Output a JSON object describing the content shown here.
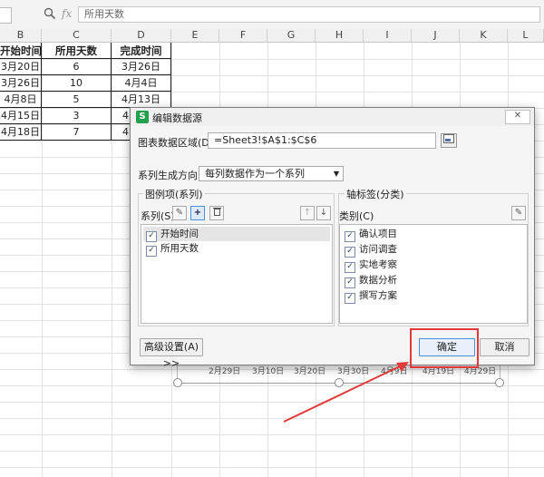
{
  "formula_bar": {
    "fx_label": "fx",
    "value": "所用天数"
  },
  "columns": [
    "B",
    "C",
    "D",
    "E",
    "F",
    "G",
    "H",
    "I",
    "J",
    "K",
    "L"
  ],
  "table": {
    "headers": [
      "开始时间",
      "所用天数",
      "完成时间"
    ],
    "rows": [
      [
        "3月20日",
        "6",
        "3月26日"
      ],
      [
        "3月26日",
        "10",
        "4月4日"
      ],
      [
        "4月8日",
        "5",
        "4月13日"
      ],
      [
        "4月15日",
        "3",
        "4"
      ],
      [
        "4月18日",
        "7",
        "4"
      ]
    ]
  },
  "chart": {
    "x_ticks": [
      "2月29日",
      "3月10日",
      "3月20日",
      "3月30日",
      "4月9日",
      "4月19日",
      "4月29日"
    ]
  },
  "dialog": {
    "title": "编辑数据源",
    "range_label": "图表数据区域(D)：",
    "range_value": "=Sheet3!$A$1:$C$6",
    "series_direction_label": "系列生成方向：",
    "series_direction_value": "每列数据作为一个系列",
    "legend_group_title": "图例项(系列)",
    "series_label": "系列(S)",
    "axis_group_title": "轴标签(分类)",
    "category_label": "类别(C)",
    "series_items": [
      "开始时间",
      "所用天数"
    ],
    "category_items": [
      "确认项目",
      "访问调查",
      "实地考察",
      "数据分析",
      "撰写方案"
    ],
    "advanced_button": "高级设置(A) >>",
    "ok_button": "确定",
    "cancel_button": "取消",
    "accent_color": "#4a90d9",
    "highlight_color": "#e23a3a"
  }
}
